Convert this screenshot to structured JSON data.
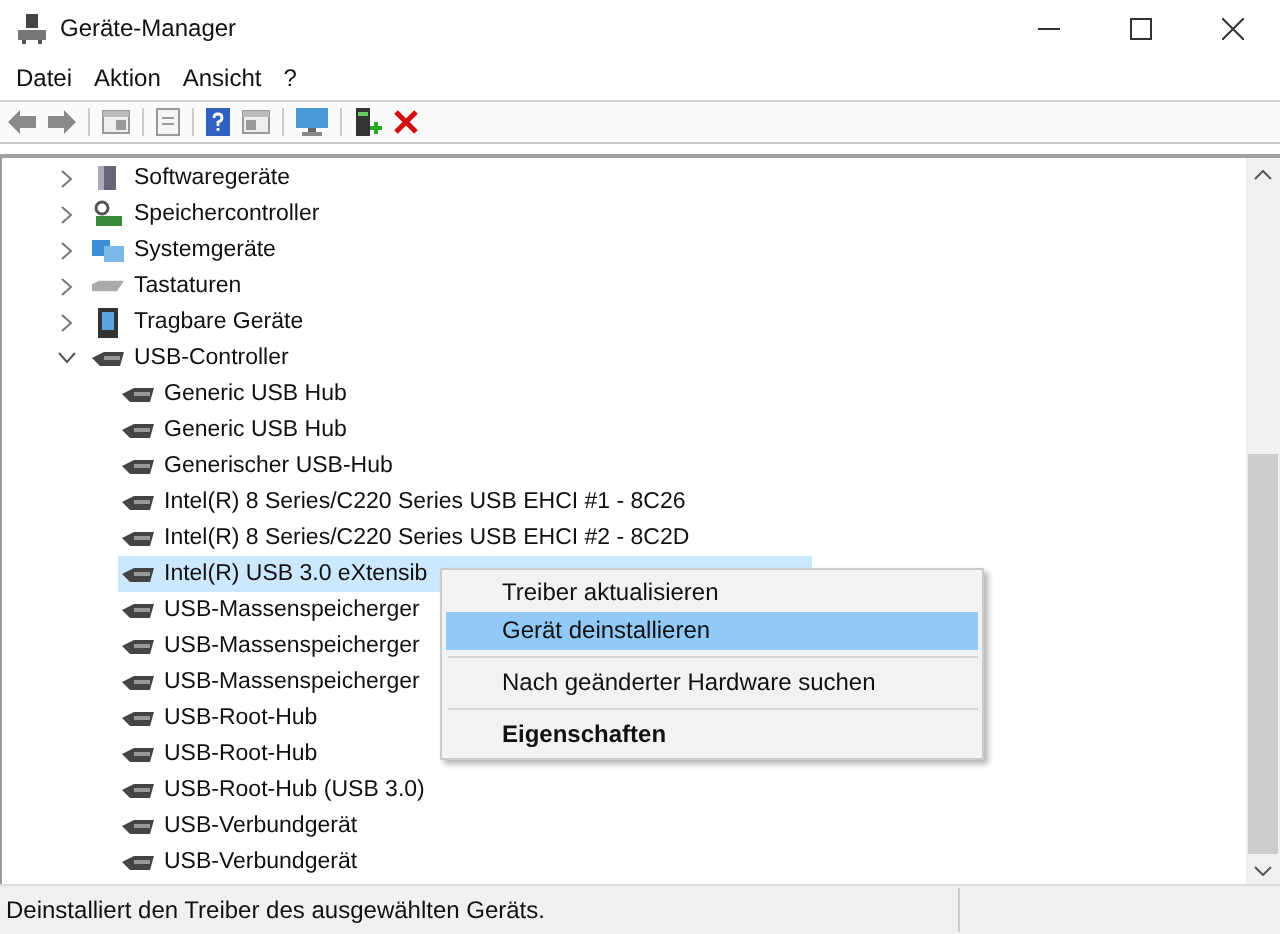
{
  "window": {
    "title": "Geräte-Manager"
  },
  "menu_bar": [
    "Datei",
    "Aktion",
    "Ansicht",
    "?"
  ],
  "tree": [
    {
      "label": "Softwaregeräte",
      "expanded": false
    },
    {
      "label": "Speichercontroller",
      "expanded": false
    },
    {
      "label": "Systemgeräte",
      "expanded": false
    },
    {
      "label": "Tastaturen",
      "expanded": false
    },
    {
      "label": "Tragbare Geräte",
      "expanded": false
    },
    {
      "label": "USB-Controller",
      "expanded": true,
      "children": [
        {
          "label": "Generic USB Hub",
          "selected": false
        },
        {
          "label": "Generic USB Hub",
          "selected": false
        },
        {
          "label": "Generischer USB-Hub",
          "selected": false
        },
        {
          "label": "Intel(R) 8 Series/C220 Series USB EHCI #1 - 8C26",
          "selected": false
        },
        {
          "label": "Intel(R) 8 Series/C220 Series USB EHCI #2 - 8C2D",
          "selected": false
        },
        {
          "label": "Intel(R) USB 3.0 eXtensib",
          "selected": true
        },
        {
          "label": "USB-Massenspeicherger",
          "selected": false
        },
        {
          "label": "USB-Massenspeicherger",
          "selected": false
        },
        {
          "label": "USB-Massenspeicherger",
          "selected": false
        },
        {
          "label": "USB-Root-Hub",
          "selected": false
        },
        {
          "label": "USB-Root-Hub",
          "selected": false
        },
        {
          "label": "USB-Root-Hub (USB 3.0)",
          "selected": false
        },
        {
          "label": "USB-Verbundgerät",
          "selected": false
        },
        {
          "label": "USB-Verbundgerät",
          "selected": false
        }
      ]
    }
  ],
  "context_menu": [
    {
      "kind": "item",
      "label": "Treiber aktualisieren",
      "selected": false
    },
    {
      "kind": "item",
      "label": "Gerät deinstallieren",
      "selected": true
    },
    {
      "kind": "separator"
    },
    {
      "kind": "item",
      "label": "Nach geänderter Hardware suchen",
      "selected": false
    },
    {
      "kind": "separator"
    },
    {
      "kind": "default",
      "label": "Eigenschaften",
      "selected": false
    }
  ],
  "status_bar": "Deinstalliert den Treiber des ausgewählten Geräts."
}
